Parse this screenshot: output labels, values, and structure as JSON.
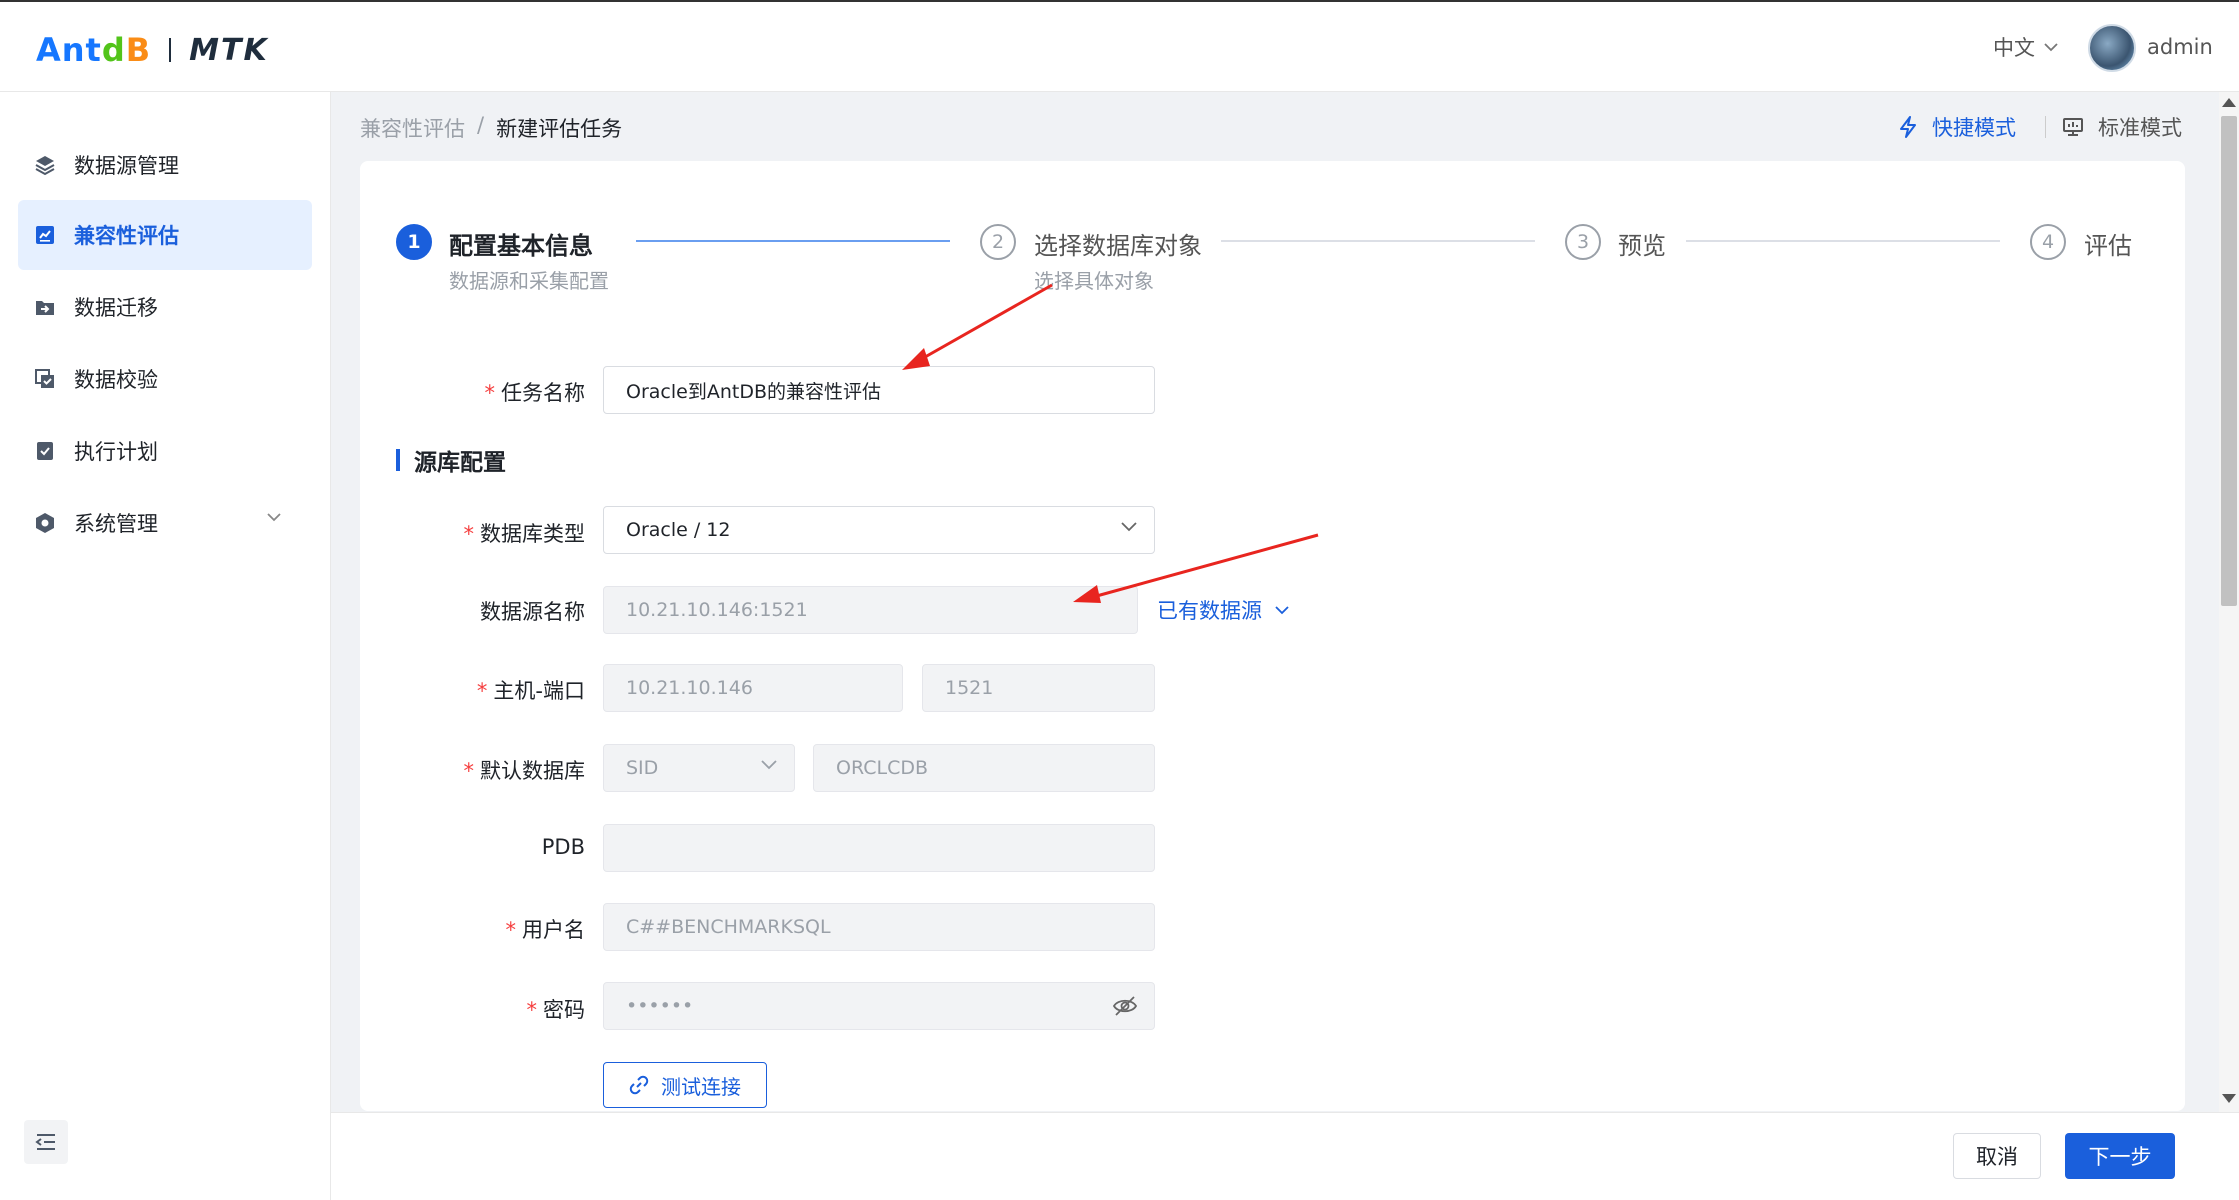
{
  "header": {
    "logo_ant_1": "Ant",
    "logo_ant_2": "d",
    "logo_ant_3": "B",
    "logo_product": "MTK",
    "language": "中文",
    "username": "admin"
  },
  "sidebar": {
    "items": [
      {
        "label": "数据源管理",
        "icon": "layers-icon"
      },
      {
        "label": "兼容性评估",
        "icon": "assessment-icon",
        "active": true
      },
      {
        "label": "数据迁移",
        "icon": "migrate-icon"
      },
      {
        "label": "数据校验",
        "icon": "verify-icon"
      },
      {
        "label": "执行计划",
        "icon": "plan-icon"
      },
      {
        "label": "系统管理",
        "icon": "settings-icon"
      }
    ]
  },
  "breadcrumb": {
    "parent": "兼容性评估",
    "separator": "/",
    "current": "新建评估任务"
  },
  "modes": {
    "quick": "快捷模式",
    "standard": "标准模式"
  },
  "steps": [
    {
      "num": "1",
      "title": "配置基本信息",
      "desc": "数据源和采集配置",
      "active": true
    },
    {
      "num": "2",
      "title": "选择数据库对象",
      "desc": "选择具体对象"
    },
    {
      "num": "3",
      "title": "预览"
    },
    {
      "num": "4",
      "title": "评估"
    }
  ],
  "form": {
    "task_name_label": "任务名称",
    "task_name_value": "Oracle到AntDB的兼容性评估",
    "section_title": "源库配置",
    "db_type_label": "数据库类型",
    "db_type_value": "Oracle / 12",
    "ds_name_label": "数据源名称",
    "ds_name_value": "10.21.10.146:1521",
    "existing_ds": "已有数据源",
    "host_port_label": "主机-端口",
    "host_value": "10.21.10.146",
    "port_value": "1521",
    "default_db_label": "默认数据库",
    "default_db_type": "SID",
    "default_db_value": "ORCLCDB",
    "pdb_label": "PDB",
    "pdb_value": "",
    "username_label": "用户名",
    "username_value": "C##BENCHMARKSQL",
    "password_label": "密码",
    "password_value": "••••••",
    "test_connection": "测试连接"
  },
  "footer": {
    "cancel": "取消",
    "next": "下一步"
  },
  "colors": {
    "primary": "#1a5fdc",
    "required": "#f53f3f",
    "annotation_arrow": "#e8251f"
  }
}
